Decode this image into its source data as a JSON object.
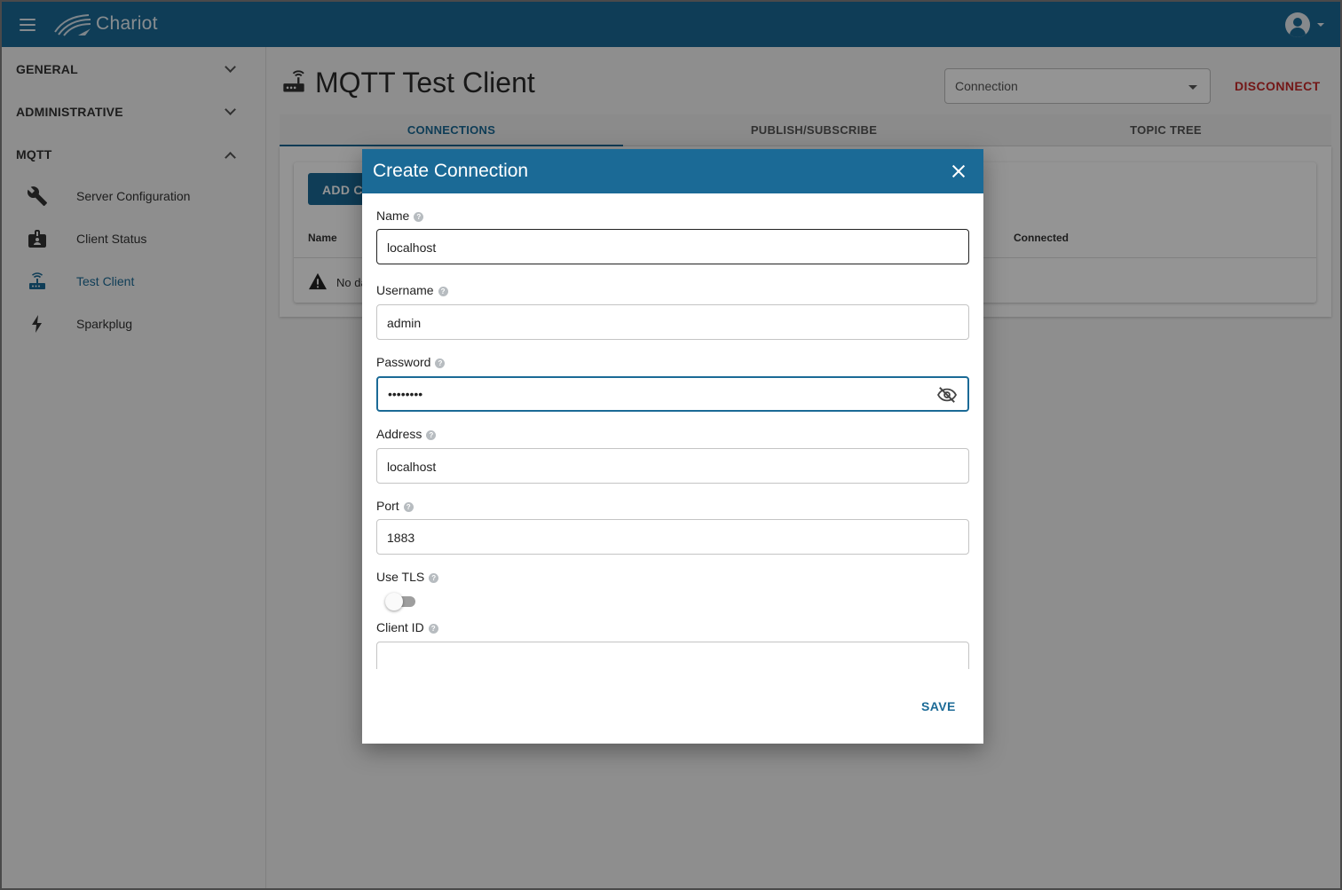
{
  "app": {
    "title": "Chariot"
  },
  "sidebar": {
    "sections": [
      {
        "label": "GENERAL",
        "expanded": false
      },
      {
        "label": "ADMINISTRATIVE",
        "expanded": false
      },
      {
        "label": "MQTT",
        "expanded": true
      }
    ],
    "items": [
      {
        "label": "Server Configuration",
        "icon": "wrench-icon"
      },
      {
        "label": "Client Status",
        "icon": "badge-icon"
      },
      {
        "label": "Test Client",
        "icon": "router-icon",
        "active": true
      },
      {
        "label": "Sparkplug",
        "icon": "lightning-icon"
      }
    ]
  },
  "main": {
    "title": "MQTT Test Client",
    "connection_select": {
      "value": "Connection"
    },
    "disconnect_label": "DISCONNECT",
    "tabs": [
      {
        "label": "CONNECTIONS",
        "active": true
      },
      {
        "label": "PUBLISH/SUBSCRIBE",
        "active": false
      },
      {
        "label": "TOPIC TREE",
        "active": false
      }
    ],
    "add_button_label": "ADD CO",
    "columns": [
      "Name",
      "Connected"
    ],
    "no_data": "No da"
  },
  "dialog": {
    "title": "Create Connection",
    "fields": {
      "name": {
        "label": "Name",
        "value": "localhost"
      },
      "username": {
        "label": "Username",
        "value": "admin"
      },
      "password": {
        "label": "Password",
        "value": "••••••••"
      },
      "address": {
        "label": "Address",
        "value": "localhost"
      },
      "port": {
        "label": "Port",
        "value": "1883"
      },
      "use_tls": {
        "label": "Use TLS",
        "checked": false
      },
      "client_id": {
        "label": "Client ID",
        "value": ""
      }
    },
    "help_glyph": "?",
    "save_label": "SAVE"
  },
  "colors": {
    "primary": "#1b6a96",
    "danger": "#c62828"
  }
}
